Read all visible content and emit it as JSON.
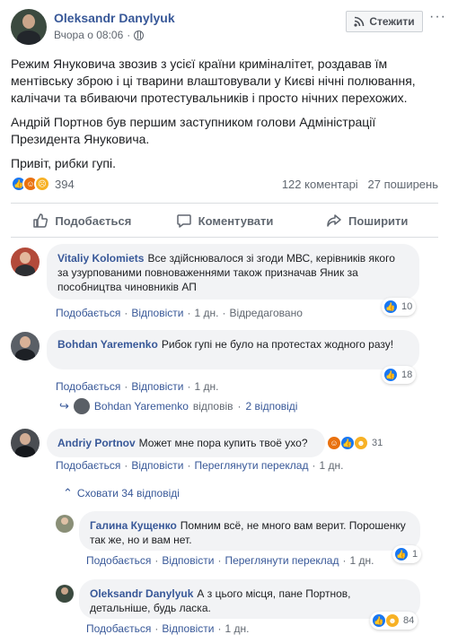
{
  "post": {
    "author": "Oleksandr Danylyuk",
    "time": "Вчора о 08:06",
    "follow_label": "Стежити",
    "more": "···",
    "paragraphs": [
      "Режим Януковича звозив з усієї країни криміналітет, роздавав їм ментівську зброю і ці тварини влаштовували у Києві нічні полювання, калічачи та вбиваючи протестувальників і просто нічних перехожих.",
      "Андрій Портнов був першим заступником голови Адміністрації Президента Януковича.",
      "Привіт, рибки гупі."
    ],
    "reaction_count": "394",
    "comments_count": "122 коментарі",
    "shares_count": "27 поширень"
  },
  "actions": {
    "like": "Подобається",
    "comment": "Коментувати",
    "share": "Поширити"
  },
  "comments": [
    {
      "author": "Vitaliy Kolomiets",
      "text": "Все здійснювалося зі згоди МВС, керівників якого за узурпованими повноваженнями також призначав Яник за пособництва чиновників АП",
      "like": "Подобається",
      "reply": "Відповісти",
      "time": "1 дн.",
      "edited": "Відредаговано",
      "reactions": "10"
    },
    {
      "author": "Bohdan Yaremenko",
      "text": "Рибок гупі не було на протестах жодного разу!",
      "like": "Подобається",
      "reply": "Відповісти",
      "time": "1 дн.",
      "reactions": "18",
      "replies_author": "Bohdan Yaremenko",
      "replies_verb": "відповів",
      "replies_count": "2 відповіді"
    },
    {
      "author": "Andriy Portnov",
      "text": "Может мне пора купить твоё ухо?",
      "like": "Подобається",
      "reply": "Відповісти",
      "translate": "Переглянути переклад",
      "time": "1 дн.",
      "reactions": "31",
      "hide_replies": "Сховати 34 відповіді"
    }
  ],
  "replies": [
    {
      "author": "Галина Кущенко",
      "text": "Помним всё, не много вам верит. Порошенку так же, но и вам нет.",
      "like": "Подобається",
      "reply": "Відповісти",
      "translate": "Переглянути переклад",
      "time": "1 дн.",
      "reactions": "1"
    },
    {
      "author": "Oleksandr Danylyuk",
      "text": "А з цього місця, пане Портнов, детальніше, будь ласка.",
      "like": "Подобається",
      "reply": "Відповісти",
      "time": "1 дн.",
      "reactions": "84"
    }
  ],
  "colors": {
    "link": "#385898",
    "like_blue": "#1877f2",
    "angry": "#e9710f",
    "sad": "#f7b125"
  }
}
